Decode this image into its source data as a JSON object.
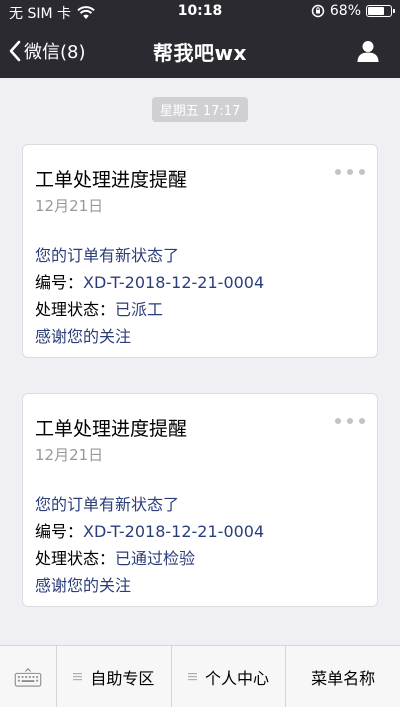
{
  "status_bar": {
    "carrier": "无 SIM 卡",
    "time": "10:18",
    "battery_text": "68%",
    "battery_level": 0.68,
    "icons": [
      "wifi-icon",
      "rotation-lock-icon",
      "battery-icon"
    ]
  },
  "nav": {
    "back_label": "微信(8)",
    "title": "帮我吧wx",
    "icons": [
      "chevron-left-icon",
      "profile-icon"
    ]
  },
  "chat": {
    "timestamp": "星期五 17:17",
    "messages": [
      {
        "title": "工单处理进度提醒",
        "date": "12月21日",
        "line1": "您的订单有新状态了",
        "number_label": "编号：",
        "number_value": "XD-T-2018-12-21-0004",
        "status_label": "处理状态：",
        "status_value": "已派工",
        "footer": "感谢您的关注"
      },
      {
        "title": "工单处理进度提醒",
        "date": "12月21日",
        "line1": "您的订单有新状态了",
        "number_label": "编号：",
        "number_value": "XD-T-2018-12-21-0004",
        "status_label": "处理状态：",
        "status_value": "已通过检验",
        "footer": "感谢您的关注"
      }
    ]
  },
  "menu": {
    "keyboard_icon": "keyboard-icon",
    "items": [
      {
        "label": "自助专区",
        "has_submenu": true
      },
      {
        "label": "个人中心",
        "has_submenu": true
      },
      {
        "label": "菜单名称",
        "has_submenu": false
      }
    ]
  },
  "colors": {
    "header_bg": "#2b2a30",
    "page_bg": "#efeff4",
    "link_text": "#2c3e7a",
    "muted_text": "#999999"
  }
}
